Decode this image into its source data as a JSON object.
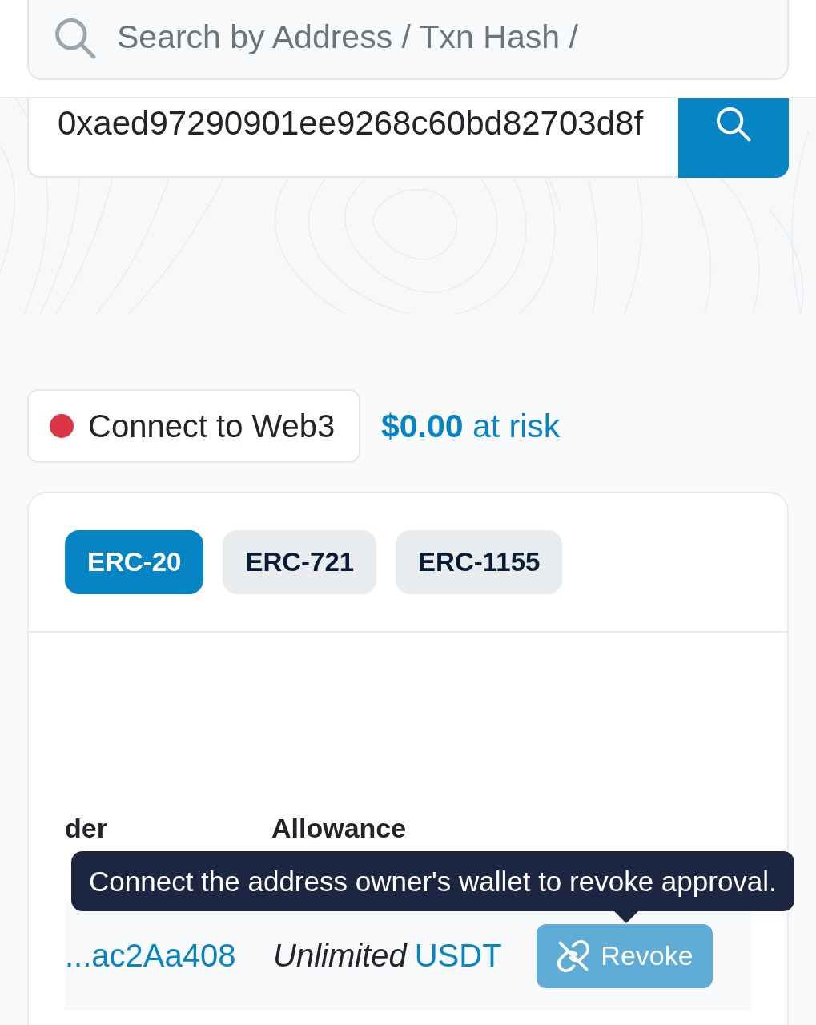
{
  "header": {
    "search": {
      "placeholder": "Search by Address / Txn Hash /"
    }
  },
  "hero": {
    "address_input": {
      "value": "0xaed97290901ee9268c60bd82703d8f"
    }
  },
  "wallet": {
    "connect_button": {
      "label": "Connect to Web3",
      "connected": false
    },
    "risk": "**$0.00** at risk"
  },
  "tabs": [
    {
      "label": "ERC-20",
      "selected": true
    },
    {
      "label": "ERC-721",
      "selected": false
    },
    {
      "label": "ERC-1155",
      "selected": false
    }
  ],
  "table": {
    "columns": [
      "der",
      "Allowance"
    ],
    "rows": [
      {
        "address": "...ac2Aa408",
        "amount": "Unlimited",
        "token": "USDT",
        "button": {
          "label": "Revoke",
          "disabled": true
        }
      }
    ]
  },
  "tooltip": {
    "text": "Connect the address owner's wallet to revoke approval."
  }
}
